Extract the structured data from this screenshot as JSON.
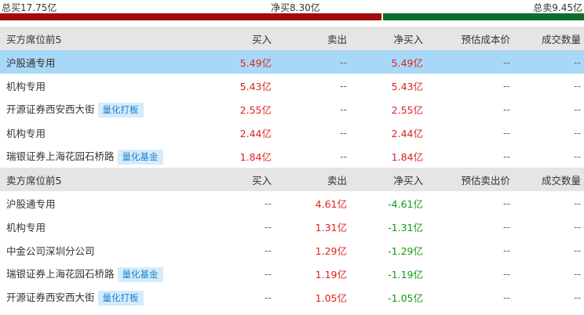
{
  "summary": {
    "total_buy": "总买17.75亿",
    "net_buy": "净买8.30亿",
    "total_sell": "总卖9.45亿",
    "buy_ratio": 0.6526
  },
  "buy_section": {
    "headers": [
      "买方席位前5",
      "买入",
      "卖出",
      "净买入",
      "预估成本价",
      "成交数量"
    ],
    "rows": [
      {
        "name": "沪股通专用",
        "tag": "",
        "buy": "5.49亿",
        "sell": "--",
        "net": "5.49亿",
        "est": "--",
        "qty": "--",
        "highlight": true
      },
      {
        "name": "机构专用",
        "tag": "",
        "buy": "5.43亿",
        "sell": "--",
        "net": "5.43亿",
        "est": "--",
        "qty": "--"
      },
      {
        "name": "开源证券西安西大街",
        "tag": "量化打板",
        "buy": "2.55亿",
        "sell": "--",
        "net": "2.55亿",
        "est": "--",
        "qty": "--"
      },
      {
        "name": "机构专用",
        "tag": "",
        "buy": "2.44亿",
        "sell": "--",
        "net": "2.44亿",
        "est": "--",
        "qty": "--"
      },
      {
        "name": "瑞银证券上海花园石桥路",
        "tag": "量化基金",
        "buy": "1.84亿",
        "sell": "--",
        "net": "1.84亿",
        "est": "--",
        "qty": "--"
      }
    ]
  },
  "sell_section": {
    "headers": [
      "卖方席位前5",
      "买入",
      "卖出",
      "净买入",
      "预估卖出价",
      "成交数量"
    ],
    "rows": [
      {
        "name": "沪股通专用",
        "tag": "",
        "buy": "--",
        "sell": "4.61亿",
        "net": "-4.61亿",
        "est": "--",
        "qty": "--"
      },
      {
        "name": "机构专用",
        "tag": "",
        "buy": "--",
        "sell": "1.31亿",
        "net": "-1.31亿",
        "est": "--",
        "qty": "--"
      },
      {
        "name": "中金公司深圳分公司",
        "tag": "",
        "buy": "--",
        "sell": "1.29亿",
        "net": "-1.29亿",
        "est": "--",
        "qty": "--"
      },
      {
        "name": "瑞银证券上海花园石桥路",
        "tag": "量化基金",
        "buy": "--",
        "sell": "1.19亿",
        "net": "-1.19亿",
        "est": "--",
        "qty": "--"
      },
      {
        "name": "开源证券西安西大街",
        "tag": "量化打板",
        "buy": "--",
        "sell": "1.05亿",
        "net": "-1.05亿",
        "est": "--",
        "qty": "--"
      }
    ]
  },
  "colors": {
    "buy_bar": "#a30a0a",
    "sell_bar": "#0e6e2e",
    "positive": "#e02020",
    "negative": "#109a10",
    "tag_bg": "#d4ecfb",
    "tag_text": "#1a7fd4",
    "highlight_row": "#a8d8f8"
  }
}
